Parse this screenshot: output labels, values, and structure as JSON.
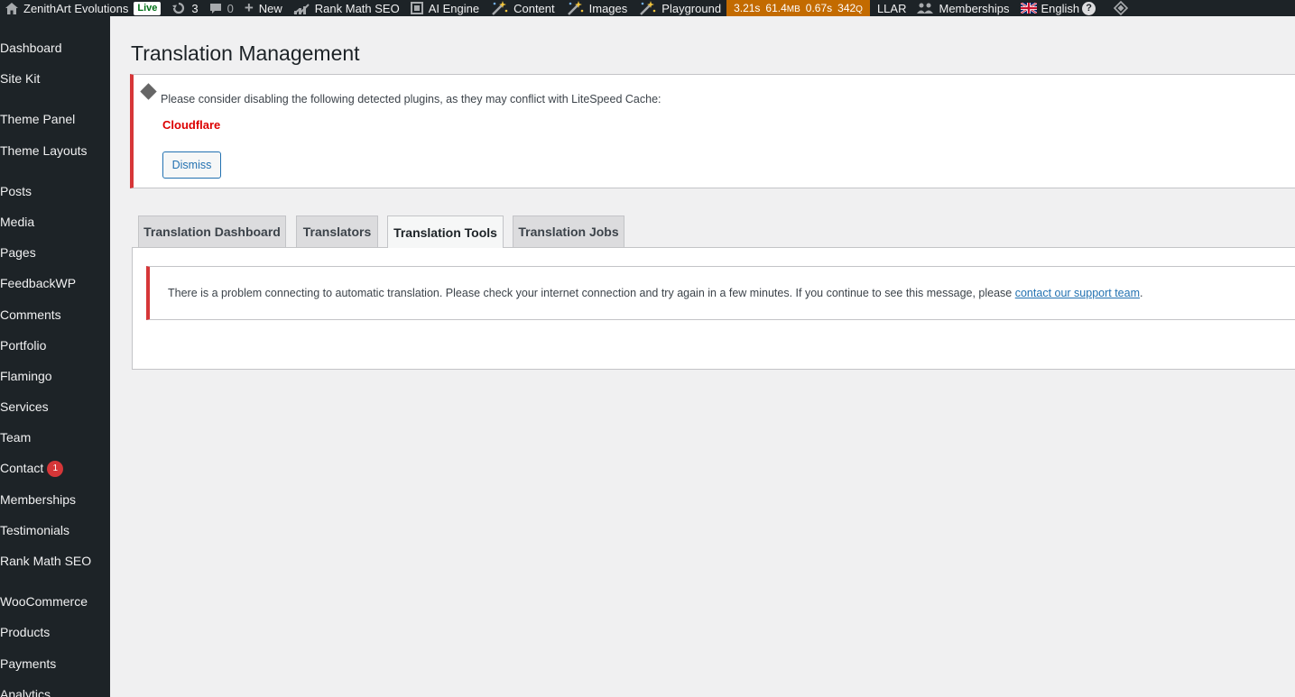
{
  "adminbar": {
    "site_name": "ZenithArt Evolutions",
    "live_badge": "Live",
    "updates_count": "3",
    "comments_count": "0",
    "new_label": "New",
    "rank_math_label": "Rank Math SEO",
    "ai_engine_label": "AI Engine",
    "content_label": "Content",
    "images_label": "Images",
    "playground_label": "Playground",
    "perf": {
      "time1": "3.21s",
      "memory_value": "61.4",
      "memory_unit": "MB",
      "time2": "0.67s",
      "queries_value": "342",
      "queries_unit": "Q"
    },
    "llar_label": "LLAR",
    "memberships_label": "Memberships",
    "language_label": "English",
    "help_label": "?"
  },
  "sidebar": {
    "items": [
      {
        "label": "Dashboard"
      },
      {
        "label": "Site Kit"
      },
      {
        "label": "Theme Panel"
      },
      {
        "label": "Theme Layouts"
      },
      {
        "label": "Posts"
      },
      {
        "label": "Media"
      },
      {
        "label": "Pages"
      },
      {
        "label": "FeedbackWP"
      },
      {
        "label": "Comments"
      },
      {
        "label": "Portfolio"
      },
      {
        "label": "Flamingo"
      },
      {
        "label": "Services"
      },
      {
        "label": "Team"
      },
      {
        "label": "Contact",
        "badge": "1"
      },
      {
        "label": "Memberships"
      },
      {
        "label": "Testimonials"
      },
      {
        "label": "Rank Math SEO"
      },
      {
        "label": "WooCommerce"
      },
      {
        "label": "Products"
      },
      {
        "label": "Payments"
      },
      {
        "label": "Analytics"
      }
    ]
  },
  "page": {
    "title": "Translation Management"
  },
  "notice": {
    "text": "Please consider disabling the following detected plugins, as they may conflict with LiteSpeed Cache:",
    "plugin": "Cloudflare",
    "dismiss_label": "Dismiss"
  },
  "tabs": [
    {
      "label": "Translation Dashboard",
      "active": false
    },
    {
      "label": "Translators",
      "active": false
    },
    {
      "label": "Translation Tools",
      "active": true
    },
    {
      "label": "Translation Jobs",
      "active": false
    }
  ],
  "error": {
    "text": "There is a problem connecting to automatic translation. Please check your internet connection and try again in a few minutes. If you continue to see this message, please ",
    "link_text": "contact our support team",
    "suffix": "."
  },
  "colors": {
    "admin_bg": "#1d2327",
    "perf_bg": "#c36b00",
    "error_border": "#d63638",
    "link": "#2271b1",
    "plugin_name": "#dc0000"
  }
}
